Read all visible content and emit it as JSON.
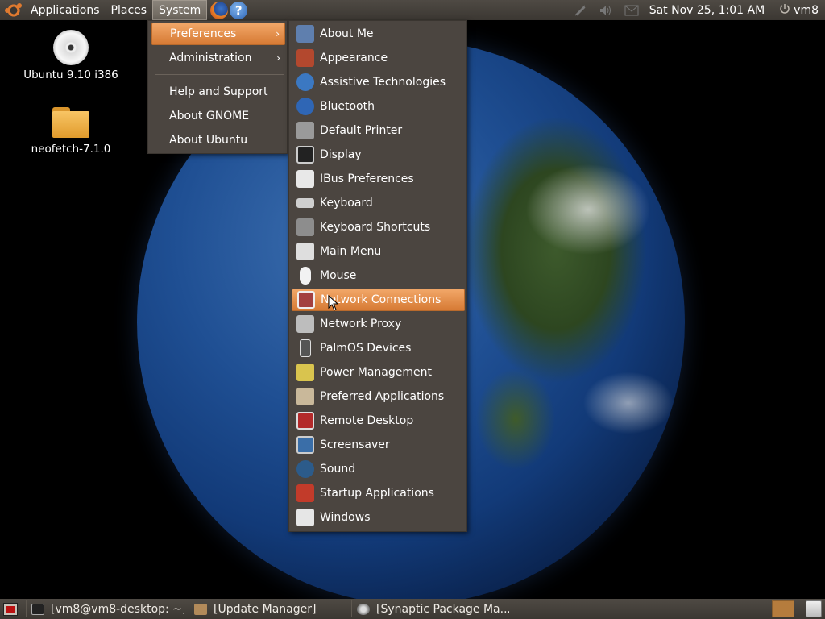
{
  "top_panel": {
    "applications": "Applications",
    "places": "Places",
    "system": "System",
    "clock": "Sat Nov 25,  1:01 AM",
    "user": "vm8",
    "help_glyph": "?"
  },
  "desktop": {
    "icons": [
      {
        "label": "Ubuntu 9.10 i386",
        "icon": "cd-icon"
      },
      {
        "label": "neofetch-7.1.0",
        "icon": "folder-icon"
      }
    ]
  },
  "system_menu": {
    "items": [
      {
        "label": "Preferences",
        "has_submenu": true,
        "selected": true
      },
      {
        "label": "Administration",
        "has_submenu": true
      },
      {
        "label": "Help and Support"
      },
      {
        "label": "About GNOME"
      },
      {
        "label": "About Ubuntu"
      }
    ],
    "arrow_glyph": "›"
  },
  "preferences_menu": {
    "items": [
      {
        "label": "About Me",
        "icon": "about-me-icon",
        "color": "#5f7fae"
      },
      {
        "label": "Appearance",
        "icon": "appearance-icon",
        "color": "#b3482e"
      },
      {
        "label": "Assistive Technologies",
        "icon": "assistive-icon",
        "color": "#3b78c2"
      },
      {
        "label": "Bluetooth",
        "icon": "bluetooth-icon",
        "color": "#2f66b5"
      },
      {
        "label": "Default Printer",
        "icon": "printer-icon",
        "color": "#9a9a9a"
      },
      {
        "label": "Display",
        "icon": "display-icon",
        "color": "#222222"
      },
      {
        "label": "IBus Preferences",
        "icon": "ibus-icon",
        "color": "#e8e8e8"
      },
      {
        "label": "Keyboard",
        "icon": "keyboard-icon",
        "color": "#cfcfcf"
      },
      {
        "label": "Keyboard Shortcuts",
        "icon": "keyboard-shortcuts-icon",
        "color": "#8d8d8d"
      },
      {
        "label": "Main Menu",
        "icon": "main-menu-icon",
        "color": "#dedede"
      },
      {
        "label": "Mouse",
        "icon": "mouse-icon",
        "color": "#f2f2f2"
      },
      {
        "label": "Network Connections",
        "icon": "network-icon",
        "color": "#a34040",
        "selected": true
      },
      {
        "label": "Network Proxy",
        "icon": "network-proxy-icon",
        "color": "#bdbdbd"
      },
      {
        "label": "PalmOS Devices",
        "icon": "palmos-icon",
        "color": "#555555"
      },
      {
        "label": "Power Management",
        "icon": "power-management-icon",
        "color": "#d9c44e"
      },
      {
        "label": "Preferred Applications",
        "icon": "preferred-apps-icon",
        "color": "#c9b89a"
      },
      {
        "label": "Remote Desktop",
        "icon": "remote-desktop-icon",
        "color": "#b32a2a"
      },
      {
        "label": "Screensaver",
        "icon": "screensaver-icon",
        "color": "#3a6ea8"
      },
      {
        "label": "Sound",
        "icon": "sound-icon",
        "color": "#2c5b8a"
      },
      {
        "label": "Startup Applications",
        "icon": "startup-apps-icon",
        "color": "#c23b2a"
      },
      {
        "label": "Windows",
        "icon": "windows-icon",
        "color": "#e6e6e6"
      }
    ]
  },
  "bottom_panel": {
    "tasks": [
      {
        "label": "[vm8@vm8-desktop: ~]",
        "icon": "terminal-icon"
      },
      {
        "label": "[Update Manager]",
        "icon": "update-manager-icon"
      },
      {
        "label": "[Synaptic Package Ma...",
        "icon": "synaptic-icon"
      }
    ]
  },
  "colors": {
    "menu_bg": "#4b4540",
    "highlight": "#e08b4c",
    "panel_bg": "#3f3a35"
  }
}
